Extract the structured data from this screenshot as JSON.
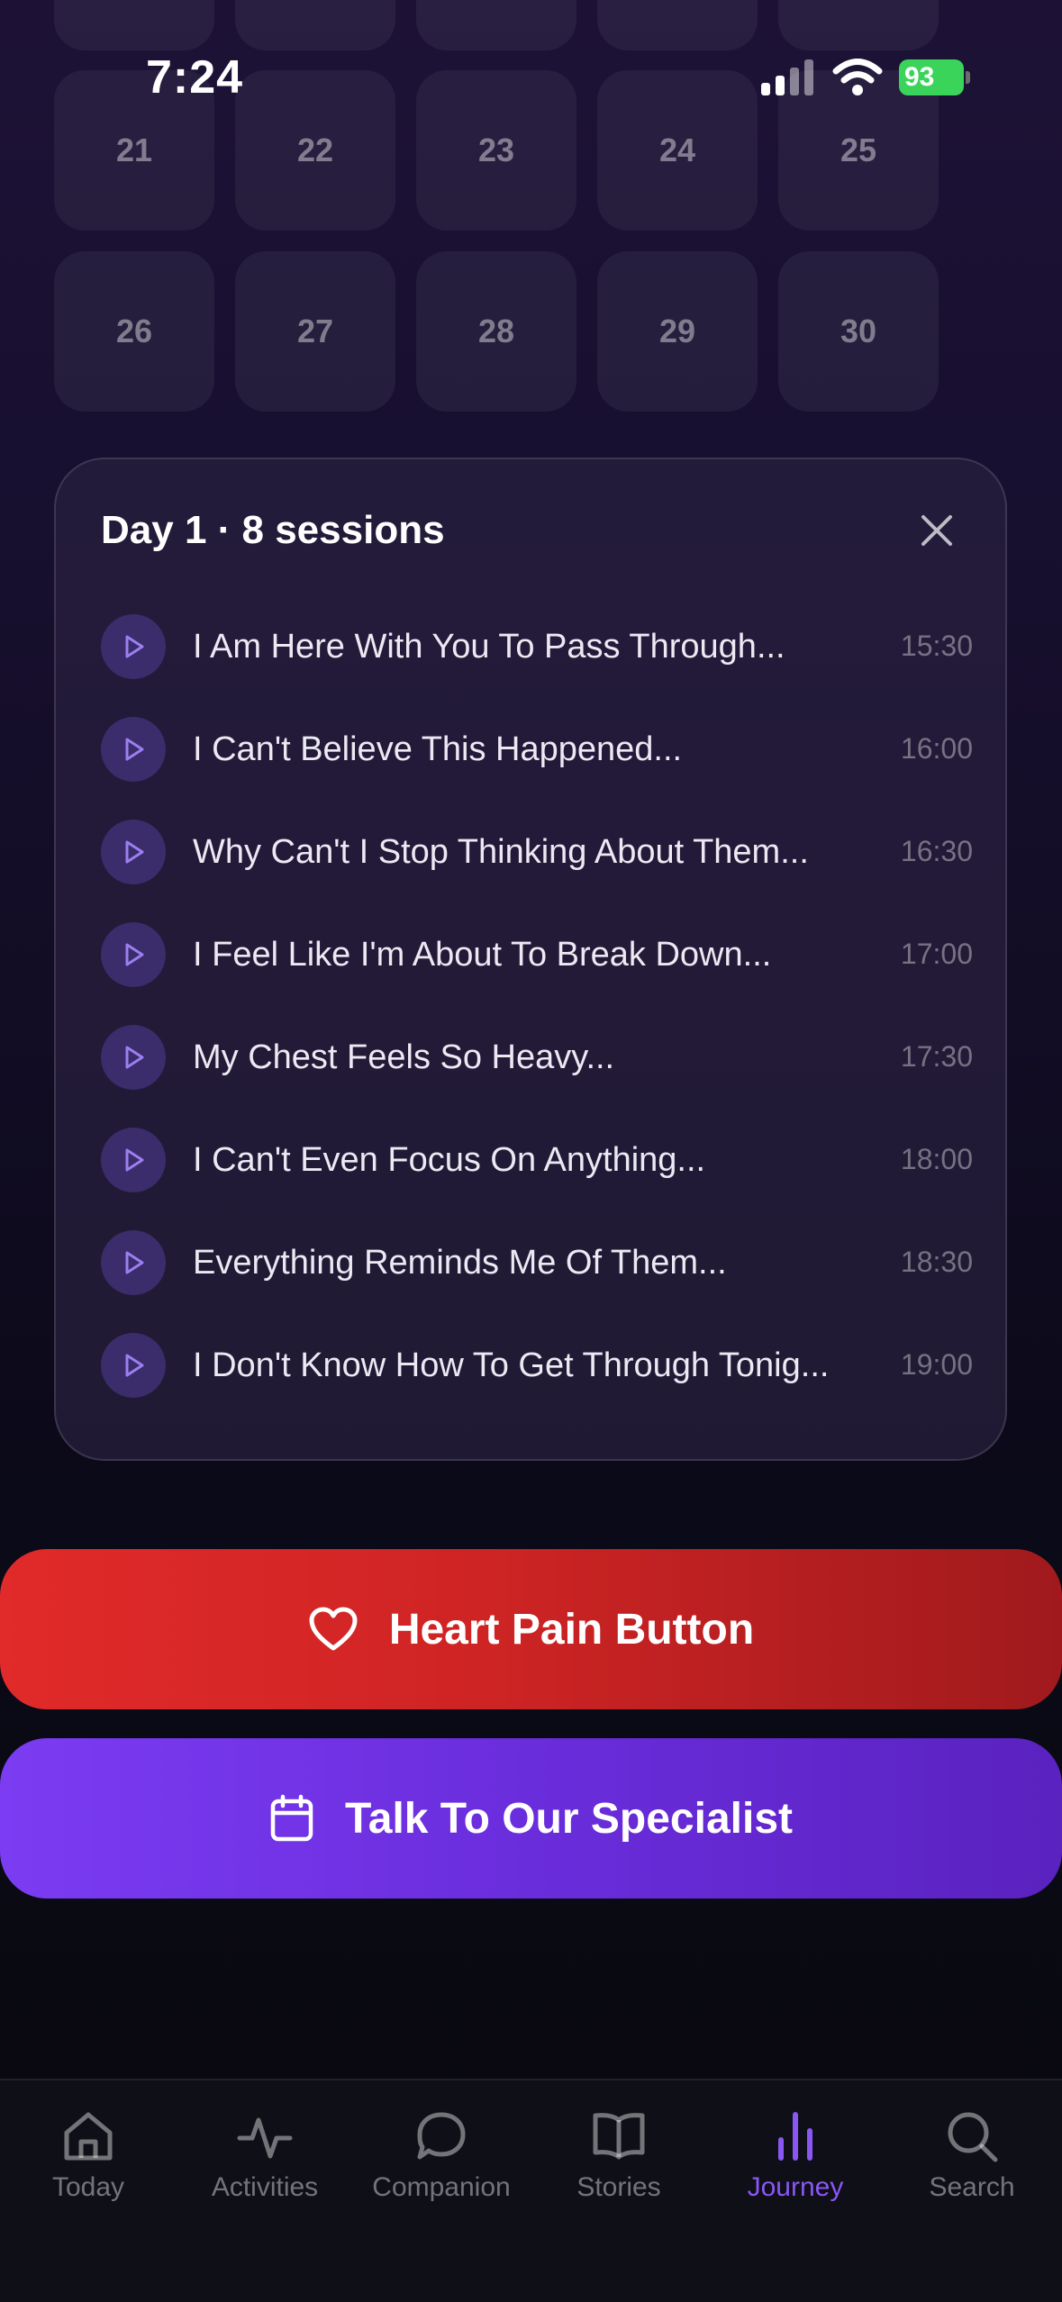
{
  "status_bar": {
    "time": "7:24",
    "battery": "93"
  },
  "calendar": {
    "top_row_days": [
      "21",
      "22",
      "23",
      "24",
      "25"
    ],
    "bottom_row_days": [
      "26",
      "27",
      "28",
      "29",
      "30"
    ]
  },
  "sessions_panel": {
    "title": "Day 1 · 8 sessions",
    "sessions": [
      {
        "title": "I Am Here With You To Pass Through...",
        "time": "15:30"
      },
      {
        "title": "I Can't Believe This Happened...",
        "time": "16:00"
      },
      {
        "title": "Why Can't I Stop Thinking About Them...",
        "time": "16:30"
      },
      {
        "title": "I Feel Like I'm About To Break Down...",
        "time": "17:00"
      },
      {
        "title": "My Chest Feels So Heavy...",
        "time": "17:30"
      },
      {
        "title": "I Can't Even Focus On Anything...",
        "time": "18:00"
      },
      {
        "title": "Everything Reminds Me Of Them...",
        "time": "18:30"
      },
      {
        "title": "I Don't Know How To Get Through Tonig...",
        "time": "19:00"
      }
    ]
  },
  "buttons": {
    "heart_pain": "Heart Pain Button",
    "specialist": "Talk To Our Specialist"
  },
  "tab_bar": {
    "tabs": [
      {
        "label": "Today",
        "icon": "home-icon"
      },
      {
        "label": "Activities",
        "icon": "activity-icon"
      },
      {
        "label": "Companion",
        "icon": "chat-bubble-icon"
      },
      {
        "label": "Stories",
        "icon": "book-icon"
      },
      {
        "label": "Journey",
        "icon": "bar-chart-icon"
      },
      {
        "label": "Search",
        "icon": "search-icon"
      }
    ],
    "active_tab": "Journey"
  },
  "colors": {
    "accent_purple": "#8a57f5",
    "heart_red": "#e12a2a",
    "specialist_purple": "#7b3cf2",
    "battery_green": "#3bd45a"
  }
}
